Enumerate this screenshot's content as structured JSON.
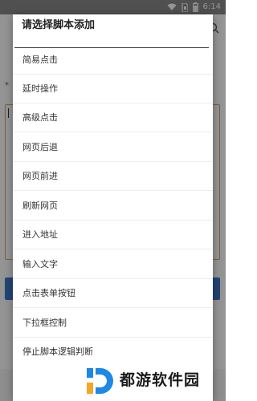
{
  "status_bar": {
    "time": "6:14",
    "icons": [
      "wifi-icon",
      "sim-icon",
      "battery-icon"
    ]
  },
  "dialog": {
    "title": "请选择脚本添加",
    "options": [
      "简易点击",
      "延时操作",
      "高级点击",
      "网页后退",
      "网页前进",
      "刷新网页",
      "进入地址",
      "输入文字",
      "点击表单按钮",
      "下拉框控制",
      "停止脚本逻辑判断"
    ]
  },
  "background": {
    "label": "*"
  },
  "watermark": {
    "text": "都游软件园"
  },
  "colors": {
    "accent_button": "#3c78c8",
    "field_border": "#e0a060",
    "logo_blue": "#1e88e5",
    "logo_orange": "#f5a623"
  }
}
